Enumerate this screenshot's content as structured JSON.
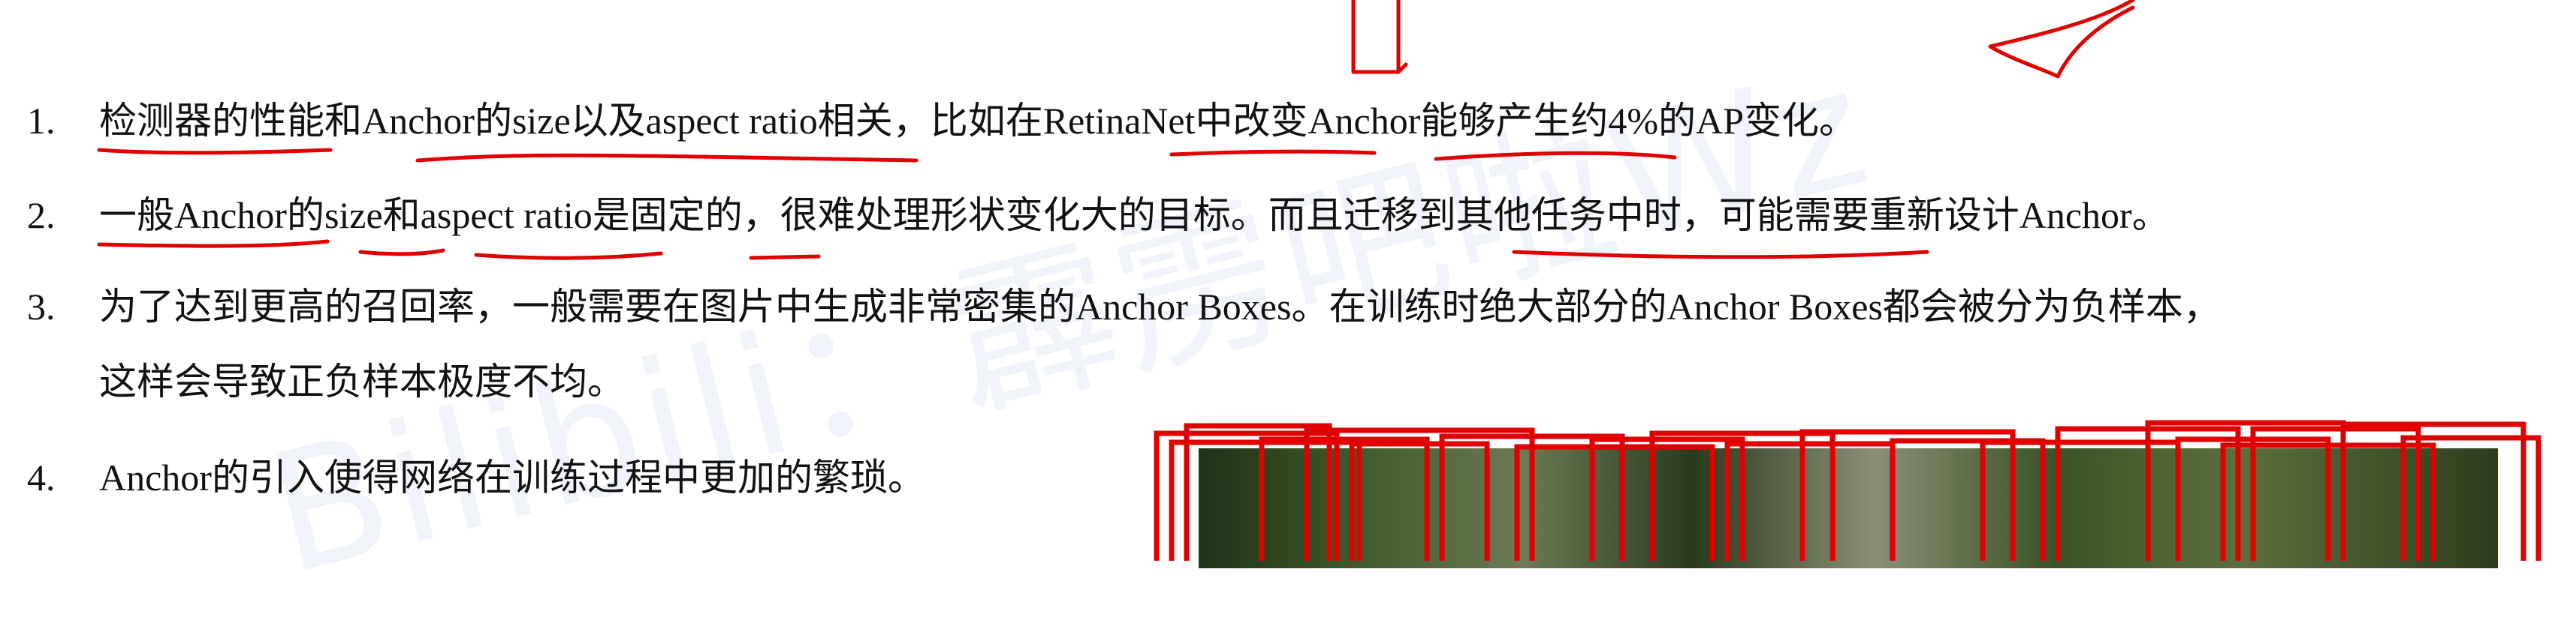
{
  "watermark": "Bilibili：霹雳吧啦Wz",
  "items": [
    {
      "num": "1.",
      "text": "检测器的性能和Anchor的size以及aspect ratio相关，比如在RetinaNet中改变Anchor能够产生约4%的AP变化。"
    },
    {
      "num": "2.",
      "text": "一般Anchor的size和aspect ratio是固定的，很难处理形状变化大的目标。而且迁移到其他任务中时，可能需要重新设计Anchor。"
    },
    {
      "num": "3.",
      "text": "为了达到更高的召回率，一般需要在图片中生成非常密集的Anchor Boxes。在训练时绝大部分的Anchor Boxes都会被分为负样本，",
      "continuation": "这样会导致正负样本极度不均。"
    },
    {
      "num": "4.",
      "text": "Anchor的引入使得网络在训练过程中更加的繁琐。"
    }
  ],
  "colors": {
    "annotation": "#e00000",
    "text": "#111111"
  }
}
